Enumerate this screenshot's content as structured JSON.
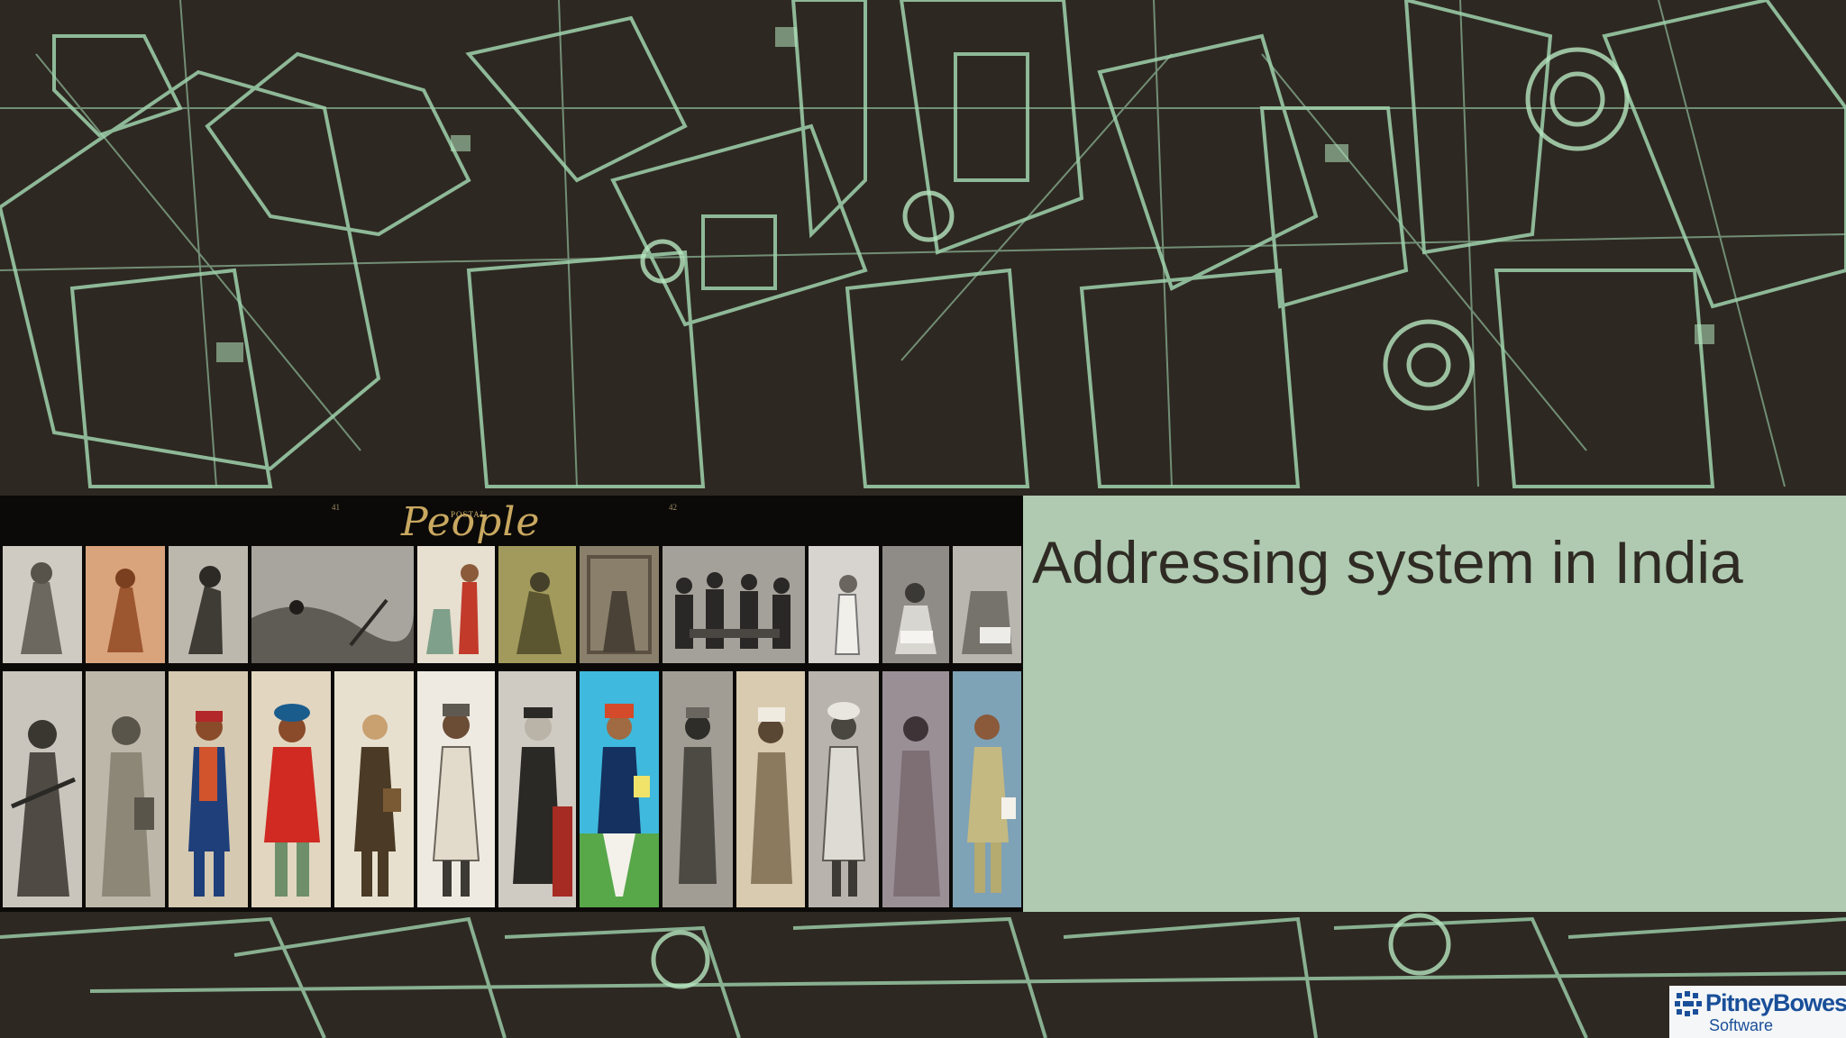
{
  "slide": {
    "title": "Addressing system in India",
    "colors": {
      "background_dark": "#2e2822",
      "line_green": "#9fd3ad",
      "title_panel": "#afcab0",
      "title_text": "#2f2b24",
      "collage_gold": "#c9a860",
      "logo_blue": "#1a4f99"
    }
  },
  "collage": {
    "title": "People",
    "title_prefix": "POSTAL",
    "page_left": "41",
    "page_right": "42",
    "description_rows": 2
  },
  "logo": {
    "name": "PitneyBowes",
    "sub": "Software",
    "icon": "pitney-bowes-mark-icon"
  }
}
